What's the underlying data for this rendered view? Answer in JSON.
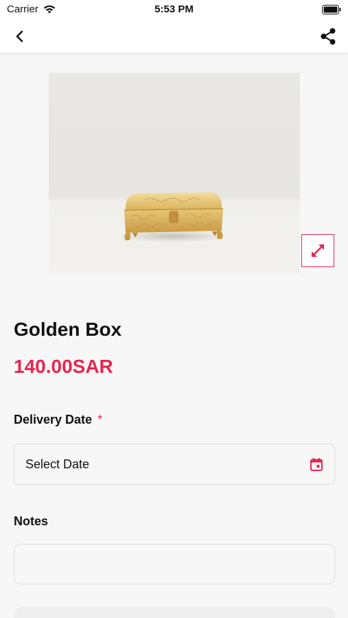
{
  "status_bar": {
    "carrier": "Carrier",
    "time": "5:53 PM"
  },
  "nav": {
    "back_icon": "chevron-left-icon",
    "share_icon": "share-icon"
  },
  "product": {
    "title": "Golden Box",
    "price": "140.00SAR",
    "image_icon": "expand-icon"
  },
  "form": {
    "delivery_label": "Delivery Date",
    "required_mark": "*",
    "date_value": "Select Date",
    "calendar_icon": "calendar-icon",
    "notes_label": "Notes",
    "notes_value": ""
  },
  "colors": {
    "accent": "#e8264f",
    "text": "#111111",
    "background": "#f7f7f7"
  }
}
